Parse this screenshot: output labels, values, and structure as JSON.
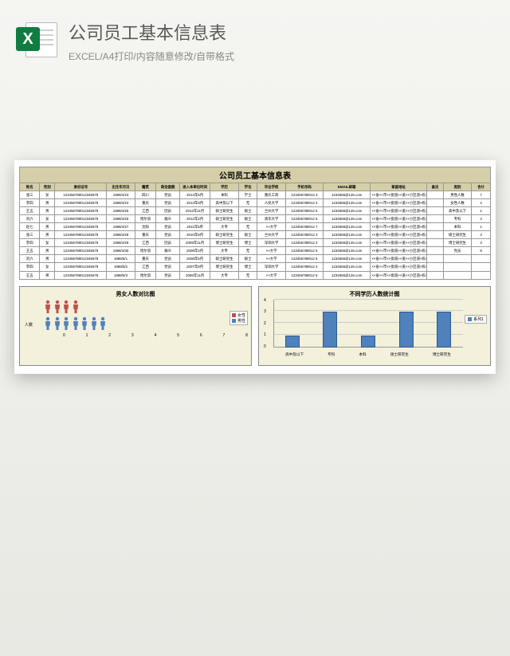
{
  "header": {
    "title": "公司员工基本信息表",
    "subtitle": "EXCEL/A4打印/内容随意修改/自带格式",
    "icon_letter": "X"
  },
  "sheet": {
    "title": "公司员工基本信息表",
    "columns": [
      "姓名",
      "性别",
      "身份证号",
      "出生年月日",
      "籍贯",
      "政治面貌",
      "进入本单位时间",
      "学历",
      "学位",
      "毕业学校",
      "手机号码",
      "EMAIL邮箱",
      "家庭地址",
      "备注",
      "类别",
      "合计"
    ],
    "rows": [
      [
        "张三",
        "女",
        "123456789012345678",
        "1988/4/23",
        "四川",
        "党员",
        "2014年5月",
        "本科",
        "学士",
        "重庆工商",
        "123456789012 3",
        "1234565@126.com",
        "××省××市××街道××道××小区道×栋×单元×室",
        "",
        "男性人数",
        "7"
      ],
      [
        "李四",
        "男",
        "123456789012345678",
        "1988/4/24",
        "重庆",
        "党员",
        "2013年8月",
        "高中及以下",
        "无",
        "人民大学",
        "123456789012 4",
        "1234565@126.com",
        "××省××市××街道××道××小区道×栋×单元×室",
        "",
        "女性人数",
        "4"
      ],
      [
        "王五",
        "男",
        "123456789012345678",
        "1988/4/25",
        "江西",
        "团员",
        "2012年11月",
        "硕士研究生",
        "硕士",
        "兰州大学",
        "123456789012 5",
        "1234565@126.com",
        "××省××市××街道××道××小区道×栋×单元×室",
        "",
        "高中及以下",
        "1"
      ],
      [
        "刘六",
        "女",
        "123456789012345679",
        "1988/4/26",
        "哈尔滨",
        "群众",
        "2012年2月",
        "硕士研究生",
        "硕士",
        "清华大学",
        "123456789012 6",
        "1234565@126.com",
        "××省××市××街道××道××小区道×栋×单元×室",
        "",
        "专科",
        "3"
      ],
      [
        "赵七",
        "男",
        "123456789012345678",
        "1988/4/27",
        "沈阳",
        "党员",
        "2011年5月",
        "大专",
        "无",
        "××大学",
        "123456789012 7",
        "1234565@126.com",
        "××省××市××街道××道××小区道×栋×单元×室",
        "",
        "本科",
        "1"
      ],
      [
        "张三",
        "男",
        "123456789012345678",
        "1988/4/28",
        "重庆",
        "党员",
        "2010年8月",
        "硕士研究生",
        "硕士",
        "兰州大学",
        "123456789012 3",
        "1234565@126.com",
        "××省××市××街道××道××小区道×栋×单元×室",
        "",
        "硕士研究生",
        "3"
      ],
      [
        "李四",
        "女",
        "123456789012345679",
        "1988/4/29",
        "江西",
        "团员",
        "2009年11月",
        "博士研究生",
        "博士",
        "深圳大学",
        "123456789012 4",
        "1234565@126.com",
        "××省××市××街道××道××小区道×栋×单元×室",
        "",
        "博士研究生",
        "3"
      ],
      [
        "王五",
        "男",
        "123456789012345678",
        "1988/4/30",
        "哈尔滨",
        "群众",
        "2009年2月",
        "大专",
        "无",
        "××大学",
        "123456789012 5",
        "1234565@126.com",
        "××省××市××街道××道××小区道×栋×单元×室",
        "",
        "党员",
        "8"
      ],
      [
        "刘六",
        "男",
        "123456789012345678",
        "1988/5/1",
        "重庆",
        "党员",
        "2008年5月",
        "硕士研究生",
        "硕士",
        "××大学",
        "123456789012 6",
        "1234565@126.com",
        "××省××市××街道××道××小区道×栋×单元×室",
        "",
        "",
        ""
      ],
      [
        "李四",
        "女",
        "123456789012345679",
        "1988/5/2",
        "江西",
        "党员",
        "2007年8月",
        "博士研究生",
        "博士",
        "深圳大学",
        "123456789012 4",
        "1234565@126.com",
        "××省××市××街道××道××小区道×栋×单元×室",
        "",
        "",
        ""
      ],
      [
        "王五",
        "男",
        "123456789012345678",
        "1988/5/3",
        "哈尔滨",
        "党员",
        "2006年11月",
        "大专",
        "无",
        "××大学",
        "123456789012 5",
        "1234565@126.com",
        "××省××市××街道××道××小区道×栋×单元×室",
        "",
        "",
        ""
      ]
    ]
  },
  "chart_data": [
    {
      "type": "bar",
      "title": "男女人数对比图",
      "orientation": "horizontal",
      "ylabel": "人数",
      "xlim": [
        0,
        8
      ],
      "xticks": [
        0,
        1,
        2,
        3,
        4,
        5,
        6,
        7,
        8
      ],
      "series": [
        {
          "name": "女性",
          "value": 4,
          "color": "#c0504d"
        },
        {
          "name": "男性",
          "value": 7,
          "color": "#4f81bd"
        }
      ],
      "legend": [
        "女性",
        "男性"
      ]
    },
    {
      "type": "bar",
      "title": "不同学历人数统计图",
      "categories": [
        "高中及以下",
        "专科",
        "本科",
        "硕士研究生",
        "博士研究生"
      ],
      "values": [
        1,
        3,
        1,
        3,
        3
      ],
      "ylim": [
        0,
        4
      ],
      "yticks": [
        0,
        1,
        2,
        3,
        4
      ],
      "legend_label": "系列1",
      "color": "#4f81bd"
    }
  ]
}
